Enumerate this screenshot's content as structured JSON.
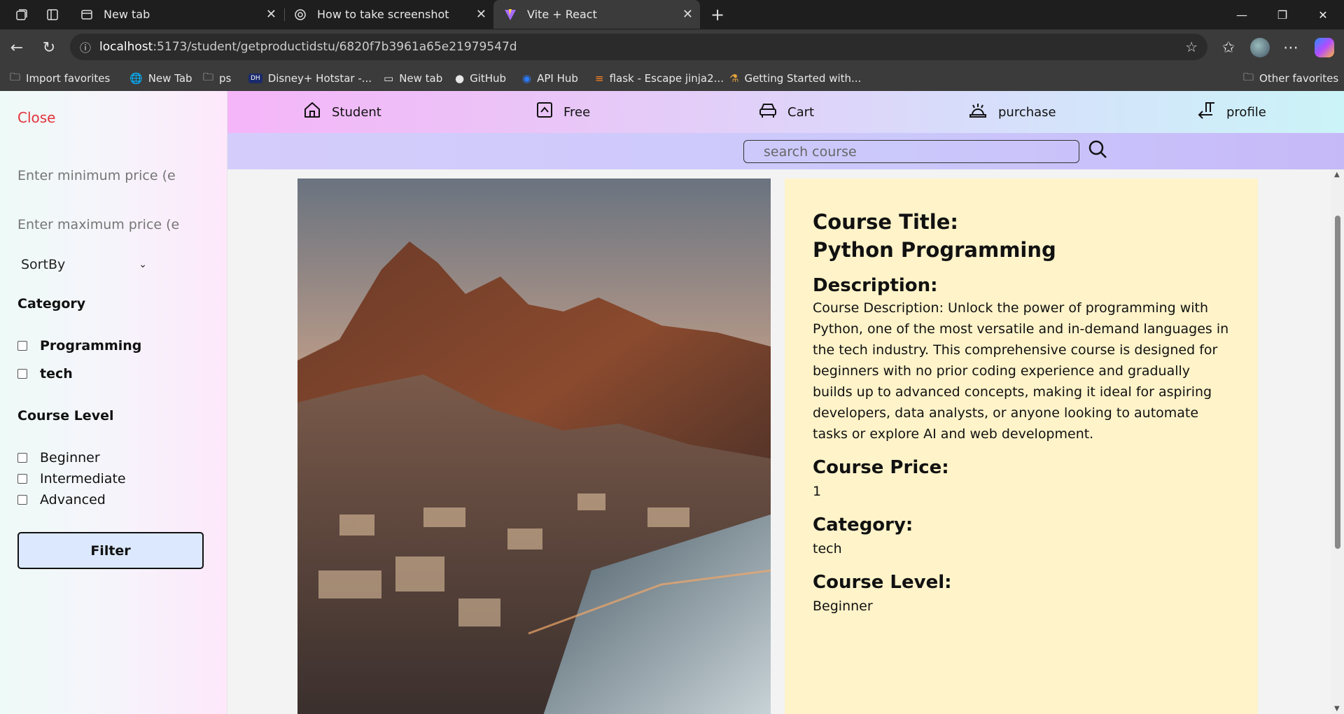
{
  "browser": {
    "tabs": [
      {
        "title": "New tab",
        "active": false
      },
      {
        "title": "How to take screenshot",
        "active": false
      },
      {
        "title": "Vite + React",
        "active": true
      }
    ],
    "url_host": "localhost",
    "url_path": ":5173/student/getproductidstu/6820f7b3961a65e21979547d",
    "bookmarks": [
      "Import favorites",
      "New Tab",
      "ps",
      "Disney+ Hotstar -...",
      "New tab",
      "GitHub",
      "API Hub",
      "flask - Escape jinja2...",
      "Getting Started with...",
      "Other favorites"
    ]
  },
  "sidebar": {
    "close_label": "Close",
    "min_price_placeholder": "Enter minimum price (e",
    "max_price_placeholder": "Enter maximum price (e",
    "sort_label": "SortBy",
    "category_heading": "Category",
    "categories": [
      "Programming",
      "tech"
    ],
    "level_heading": "Course Level",
    "levels": [
      "Beginner",
      "Intermediate",
      "Advanced"
    ],
    "filter_button": "Filter"
  },
  "nav": {
    "items": [
      "Student",
      "Free",
      "Cart",
      "purchase",
      "profile"
    ],
    "search_placeholder": "search course"
  },
  "course": {
    "title_label": "Course Title:",
    "title": "Python Programming",
    "description_label": "Description:",
    "description": "Course Description: Unlock the power of programming with Python, one of the most versatile and in-demand languages in the tech industry. This comprehensive course is designed for beginners with no prior coding experience and gradually builds up to advanced concepts, making it ideal for aspiring developers, data analysts, or anyone looking to automate tasks or explore AI and web development.",
    "price_label": "Course Price:",
    "price": "1",
    "category_label": "Category:",
    "category": "tech",
    "level_label": "Course Level:",
    "level": "Beginner"
  },
  "colors": {
    "close_red": "#e0353c",
    "details_bg": "#fef3c9",
    "filter_bg": "#dbe8fd"
  }
}
